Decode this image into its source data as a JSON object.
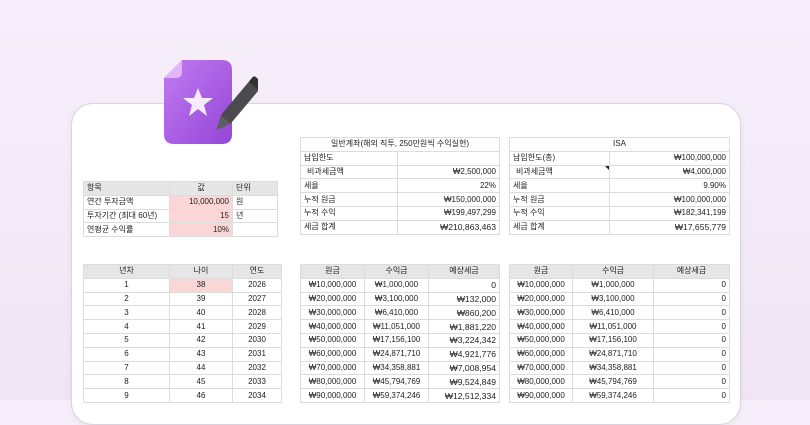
{
  "param_table": {
    "headers": [
      "항목",
      "값",
      "단위"
    ],
    "rows": [
      {
        "label": "연간 투자금액",
        "value": "10,000,000",
        "unit": "원"
      },
      {
        "label": "투자기간 (최대 60년)",
        "value": "15",
        "unit": "년"
      },
      {
        "label": "연평균 수익률",
        "value": "10%",
        "unit": ""
      }
    ]
  },
  "general_summary": {
    "title": "일반계좌(해외 직투, 250만원씩 수익실현)",
    "rows": [
      {
        "label": "납입한도",
        "value": ""
      },
      {
        "label": "비과세금액",
        "value": "₩2,500,000"
      },
      {
        "label": "세율",
        "value": "22%"
      },
      {
        "label": "누적 원금",
        "value": "₩150,000,000"
      },
      {
        "label": "누적 수익",
        "value": "₩199,497,299"
      },
      {
        "label": "세금 합계",
        "value": "₩210,863,463"
      }
    ]
  },
  "isa_summary": {
    "title": "ISA",
    "rows": [
      {
        "label": "납입한도(총)",
        "value": "₩100,000,000"
      },
      {
        "label": "비과세금액",
        "value": "₩4,000,000"
      },
      {
        "label": "세율",
        "value": "9.90%"
      },
      {
        "label": "누적 원금",
        "value": "₩100,000,000"
      },
      {
        "label": "누적 수익",
        "value": "₩182,341,199"
      },
      {
        "label": "세금 합계",
        "value": "₩17,655,779"
      }
    ]
  },
  "year_table": {
    "headers": [
      "년차",
      "나이",
      "연도"
    ],
    "rows": [
      [
        "1",
        "38",
        "2026"
      ],
      [
        "2",
        "39",
        "2027"
      ],
      [
        "3",
        "40",
        "2028"
      ],
      [
        "4",
        "41",
        "2029"
      ],
      [
        "5",
        "42",
        "2030"
      ],
      [
        "6",
        "43",
        "2031"
      ],
      [
        "7",
        "44",
        "2032"
      ],
      [
        "8",
        "45",
        "2033"
      ],
      [
        "9",
        "46",
        "2034"
      ]
    ]
  },
  "general_table": {
    "headers": [
      "원금",
      "수익금",
      "예상세금"
    ],
    "rows": [
      [
        "₩10,000,000",
        "₩1,000,000",
        "0"
      ],
      [
        "₩20,000,000",
        "₩3,100,000",
        "₩132,000"
      ],
      [
        "₩30,000,000",
        "₩6,410,000",
        "₩860,200"
      ],
      [
        "₩40,000,000",
        "₩11,051,000",
        "₩1,881,220"
      ],
      [
        "₩50,000,000",
        "₩17,156,100",
        "₩3,224,342"
      ],
      [
        "₩60,000,000",
        "₩24,871,710",
        "₩4,921,776"
      ],
      [
        "₩70,000,000",
        "₩34,358,881",
        "₩7,008,954"
      ],
      [
        "₩80,000,000",
        "₩45,794,769",
        "₩9,524,849"
      ],
      [
        "₩90,000,000",
        "₩59,374,246",
        "₩12,512,334"
      ]
    ]
  },
  "isa_table": {
    "headers": [
      "원금",
      "수익금",
      "예상세금"
    ],
    "rows": [
      [
        "₩10,000,000",
        "₩1,000,000",
        "0"
      ],
      [
        "₩20,000,000",
        "₩3,100,000",
        "0"
      ],
      [
        "₩30,000,000",
        "₩6,410,000",
        "0"
      ],
      [
        "₩40,000,000",
        "₩11,051,000",
        "0"
      ],
      [
        "₩50,000,000",
        "₩17,156,100",
        "0"
      ],
      [
        "₩60,000,000",
        "₩24,871,710",
        "0"
      ],
      [
        "₩70,000,000",
        "₩34,358,881",
        "0"
      ],
      [
        "₩80,000,000",
        "₩45,794,769",
        "0"
      ],
      [
        "₩90,000,000",
        "₩59,374,246",
        "0"
      ]
    ]
  },
  "icon": "document-edit-icon",
  "colors": {
    "accent": "#a35de6",
    "input_highlight": "#fbd6d6",
    "header_bg": "#e6e6e6"
  }
}
